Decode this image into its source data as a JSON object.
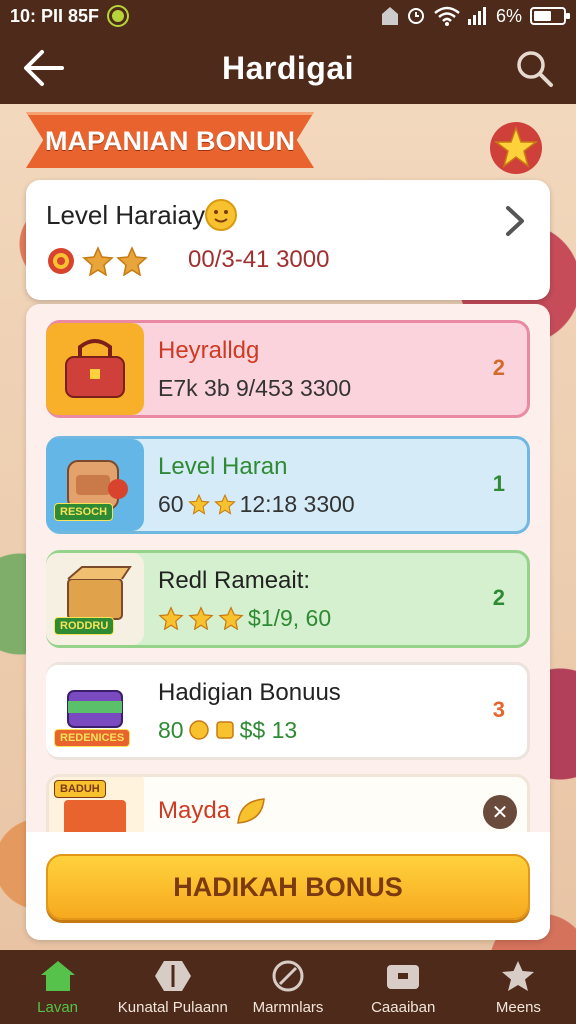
{
  "status": {
    "time": "10: PII 85F",
    "battery": "6%",
    "battery_level": 0.6
  },
  "header": {
    "title": "Hardigai"
  },
  "ribbon": {
    "title": "MAPANIAN BONUN"
  },
  "level_card": {
    "title": "Level Haraiay",
    "stats": "00/3-41 3000"
  },
  "rows": [
    {
      "name": "Heyralldg",
      "meta": "E7k 3b 9/453 3300",
      "count": "2",
      "badge": ""
    },
    {
      "name": "Level Haran",
      "meta_prefix": "60",
      "meta": "12:18 3300",
      "count": "1",
      "badge": "RESOCH"
    },
    {
      "name": "Redl Rameait:",
      "meta": "$1/9, 60",
      "count": "2",
      "badge": "RODDRU"
    },
    {
      "name": "Hadigian Bonuus",
      "meta_prefix": "80",
      "meta": "$$ 13",
      "count": "3",
      "badge": "REDENICES"
    },
    {
      "name": "Mayda",
      "meta": "",
      "count": "",
      "badge": "BADUH"
    }
  ],
  "cta": {
    "label": "HADIKAH BONUS"
  },
  "nav": [
    {
      "label": "Lavan",
      "icon": "home-icon",
      "active": true
    },
    {
      "label": "Kunatal Pulaann",
      "icon": "hexagon-icon",
      "active": false
    },
    {
      "label": "Marmnlars",
      "icon": "compass-icon",
      "active": false
    },
    {
      "label": "Caaaiban",
      "icon": "wallet-icon",
      "active": false
    },
    {
      "label": "Meens",
      "icon": "star-icon",
      "active": false
    }
  ],
  "colors": {
    "brown": "#4d2a19",
    "orange": "#e8632e",
    "green": "#2f8a34",
    "yellow": "#ffd23c"
  }
}
